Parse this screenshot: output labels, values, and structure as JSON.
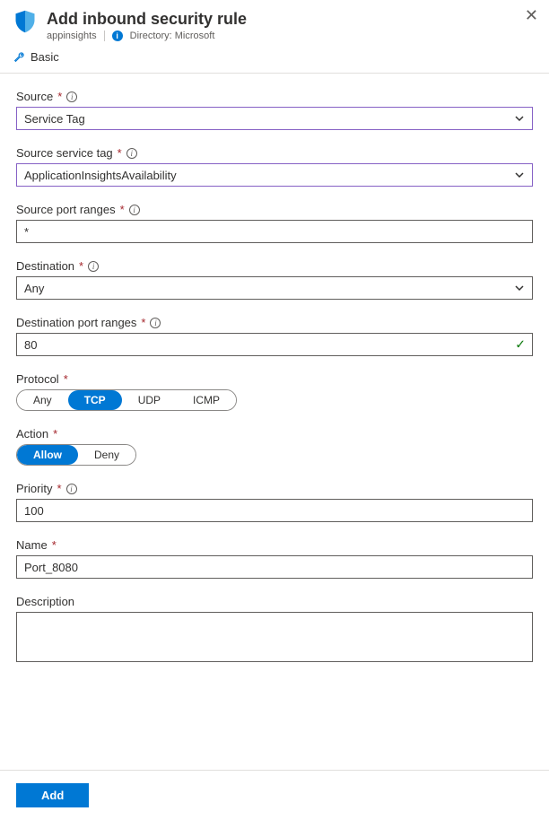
{
  "header": {
    "title": "Add inbound security rule",
    "resource": "appinsights",
    "directory_label": "Directory: Microsoft"
  },
  "toolbar": {
    "basic_label": "Basic"
  },
  "fields": {
    "source": {
      "label": "Source",
      "value": "Service Tag"
    },
    "source_service_tag": {
      "label": "Source service tag",
      "value": "ApplicationInsightsAvailability"
    },
    "source_port_ranges": {
      "label": "Source port ranges",
      "value": "*"
    },
    "destination": {
      "label": "Destination",
      "value": "Any"
    },
    "destination_port_ranges": {
      "label": "Destination port ranges",
      "value": "80"
    },
    "protocol": {
      "label": "Protocol",
      "options": [
        "Any",
        "TCP",
        "UDP",
        "ICMP"
      ],
      "selected": "TCP"
    },
    "action": {
      "label": "Action",
      "options": [
        "Allow",
        "Deny"
      ],
      "selected": "Allow"
    },
    "priority": {
      "label": "Priority",
      "value": "100"
    },
    "name": {
      "label": "Name",
      "value": "Port_8080"
    },
    "description": {
      "label": "Description",
      "value": ""
    }
  },
  "footer": {
    "add_label": "Add"
  }
}
